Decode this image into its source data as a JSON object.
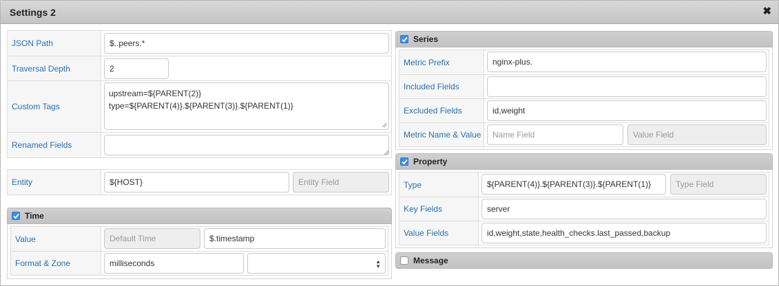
{
  "window": {
    "title": "Settings 2",
    "close_icon": "close-icon"
  },
  "left": {
    "json_path": {
      "label": "JSON Path",
      "value": "$..peers.*"
    },
    "traversal_depth": {
      "label": "Traversal Depth",
      "value": "2"
    },
    "custom_tags": {
      "label": "Custom Tags",
      "line1": "upstream=${PARENT(2)}",
      "line2": "type=${PARENT(4)}.${PARENT(3)}.${PARENT(1)}"
    },
    "renamed_fields": {
      "label": "Renamed Fields",
      "value": ""
    },
    "entity": {
      "label": "Entity",
      "value": "${HOST}",
      "field_placeholder": "Entity Field"
    },
    "time": {
      "title": "Time",
      "checked": true,
      "value": {
        "label": "Value",
        "default_placeholder": "Default Time",
        "value": "$.timestamp"
      },
      "format_zone": {
        "label": "Format & Zone",
        "format": "milliseconds",
        "zone": ""
      }
    }
  },
  "right": {
    "series": {
      "title": "Series",
      "checked": true,
      "metric_prefix": {
        "label": "Metric Prefix",
        "value": "nginx-plus."
      },
      "included_fields": {
        "label": "Included Fields",
        "value": ""
      },
      "excluded_fields": {
        "label": "Excluded Fields",
        "value": "id,weight"
      },
      "metric_name_value": {
        "label": "Metric Name & Value",
        "name_placeholder": "Name Field",
        "value_placeholder": "Value Field"
      }
    },
    "property": {
      "title": "Property",
      "checked": true,
      "type": {
        "label": "Type",
        "value": "${PARENT(4)}.${PARENT(3)}.${PARENT(1)}",
        "field_placeholder": "Type Field"
      },
      "key_fields": {
        "label": "Key Fields",
        "value": "server"
      },
      "value_fields": {
        "label": "Value Fields",
        "value": "id,weight,state,health_checks.last_passed,backup"
      }
    },
    "message": {
      "title": "Message",
      "checked": false
    }
  },
  "colors": {
    "accent": "#3b8ee8",
    "label_text": "#2a6fb0",
    "header_bg": "#c8c8c8"
  }
}
